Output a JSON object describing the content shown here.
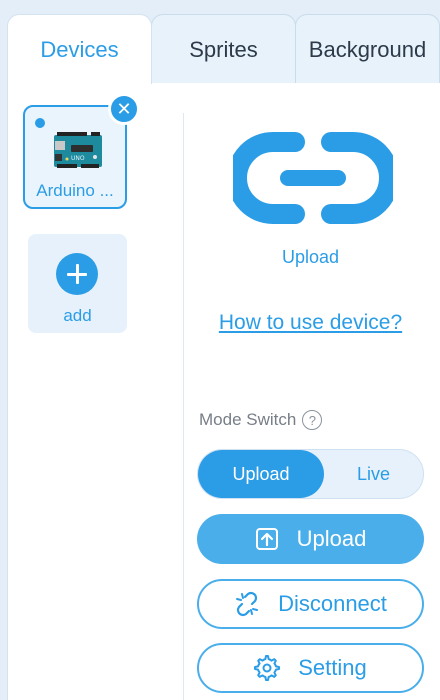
{
  "tabs": {
    "devices": "Devices",
    "sprites": "Sprites",
    "background": "Background"
  },
  "devices": [
    {
      "label": "Arduino ...",
      "icon": "arduino-board-image",
      "selected": true
    }
  ],
  "add_device": {
    "label": "add",
    "icon": "plus-icon"
  },
  "connection": {
    "icon": "link-icon",
    "caption": "Upload"
  },
  "howto_link": "How to use device?",
  "mode_switch": {
    "label": "Mode Switch",
    "options": [
      "Upload",
      "Live"
    ],
    "selected": "Upload"
  },
  "buttons": {
    "upload": "Upload",
    "disconnect": "Disconnect",
    "setting": "Setting"
  },
  "colors": {
    "accent": "#2b9de6",
    "background": "#e3eef8"
  }
}
